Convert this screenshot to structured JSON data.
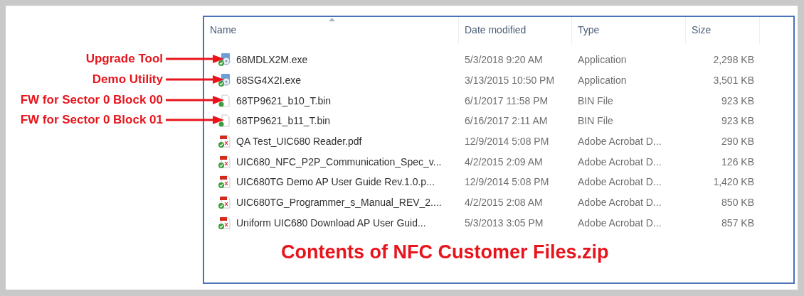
{
  "columns": [
    {
      "label": "Name",
      "sorted": true
    },
    {
      "label": "Date modified",
      "sorted": false
    },
    {
      "label": "Type",
      "sorted": false
    },
    {
      "label": "Size",
      "sorted": false
    }
  ],
  "files": [
    {
      "name": "68MDLX2M.exe",
      "date": "5/3/2018 9:20 AM",
      "type": "Application",
      "size": "2,298 KB",
      "kind": "application",
      "annotation": "Upgrade Tool"
    },
    {
      "name": "68SG4X2I.exe",
      "date": "3/13/2015 10:50 PM",
      "type": "Application",
      "size": "3,501 KB",
      "kind": "application",
      "annotation": "Demo Utility"
    },
    {
      "name": "68TP9621_b10_T.bin",
      "date": "6/1/2017 11:58 PM",
      "type": "BIN File",
      "size": "923 KB",
      "kind": "bin",
      "annotation": "FW for Sector 0 Block 00"
    },
    {
      "name": "68TP9621_b11_T.bin",
      "date": "6/16/2017 2:11 AM",
      "type": "BIN File",
      "size": "923 KB",
      "kind": "bin",
      "annotation": "FW for Sector 0 Block 01"
    },
    {
      "name": "QA Test_UIC680 Reader.pdf",
      "date": "12/9/2014 5:08 PM",
      "type": "Adobe Acrobat D...",
      "size": "290 KB",
      "kind": "pdf"
    },
    {
      "name": "UIC680_NFC_P2P_Communication_Spec_v...",
      "date": "4/2/2015 2:09 AM",
      "type": "Adobe Acrobat D...",
      "size": "126 KB",
      "kind": "pdf"
    },
    {
      "name": "UIC680TG Demo AP User Guide Rev.1.0.p...",
      "date": "12/9/2014 5:08 PM",
      "type": "Adobe Acrobat D...",
      "size": "1,420 KB",
      "kind": "pdf"
    },
    {
      "name": "UIC680TG_Programmer_s_Manual_REV_2....",
      "date": "4/2/2015 2:08 AM",
      "type": "Adobe Acrobat D...",
      "size": "850 KB",
      "kind": "pdf"
    },
    {
      "name": "Uniform UIC680 Download AP User Guid...",
      "date": "5/3/2013 3:05 PM",
      "type": "Adobe Acrobat D...",
      "size": "857 KB",
      "kind": "pdf"
    }
  ],
  "caption": "Contents of NFC Customer Files.zip"
}
